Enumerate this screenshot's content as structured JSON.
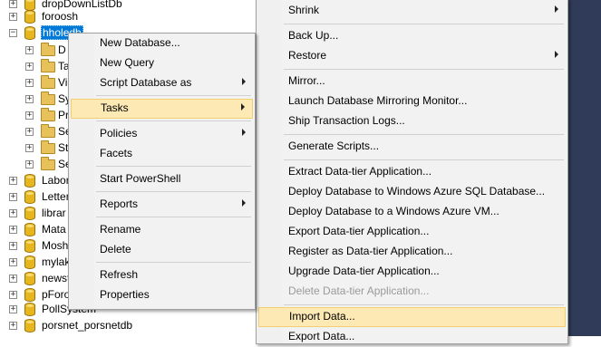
{
  "tree": {
    "items": [
      {
        "label": "dropDownListDb",
        "expander": "+",
        "type": "db"
      },
      {
        "label": "foroosh",
        "expander": "+",
        "type": "db"
      },
      {
        "label": "hholedb",
        "expander": "−",
        "type": "db",
        "selected": true
      },
      {
        "label": "D",
        "type": "folder"
      },
      {
        "label": "Ta",
        "type": "folder"
      },
      {
        "label": "Vi",
        "type": "folder"
      },
      {
        "label": "Sy",
        "type": "folder"
      },
      {
        "label": "Pr",
        "type": "folder"
      },
      {
        "label": "Se",
        "type": "folder"
      },
      {
        "label": "St",
        "type": "folder"
      },
      {
        "label": "Se",
        "type": "folder"
      },
      {
        "label": "Labor",
        "expander": "+",
        "type": "db"
      },
      {
        "label": "Letter",
        "expander": "+",
        "type": "db"
      },
      {
        "label": "librar",
        "expander": "+",
        "type": "db"
      },
      {
        "label": "Mata",
        "expander": "+",
        "type": "db"
      },
      {
        "label": "Mosh",
        "expander": "+",
        "type": "db"
      },
      {
        "label": "mylak",
        "expander": "+",
        "type": "db"
      },
      {
        "label": "newst",
        "expander": "+",
        "type": "db"
      },
      {
        "label": "pForo",
        "expander": "+",
        "type": "db"
      },
      {
        "label": "PollSystem",
        "expander": "+",
        "type": "db"
      },
      {
        "label": "porsnet_porsnetdb",
        "expander": "+",
        "type": "db"
      }
    ]
  },
  "context_menu": {
    "items": [
      {
        "label": "New Database..."
      },
      {
        "label": "New Query"
      },
      {
        "label": "Script Database as",
        "submenu": true
      },
      {
        "label": "Tasks",
        "submenu": true,
        "highlighted": true
      },
      {
        "label": "Policies",
        "submenu": true
      },
      {
        "label": "Facets"
      },
      {
        "label": "Start PowerShell"
      },
      {
        "label": "Reports",
        "submenu": true
      },
      {
        "label": "Rename"
      },
      {
        "label": "Delete"
      },
      {
        "label": "Refresh"
      },
      {
        "label": "Properties"
      }
    ]
  },
  "tasks_menu": {
    "items": [
      {
        "label": "Shrink",
        "submenu": true
      },
      {
        "label": "Back Up..."
      },
      {
        "label": "Restore",
        "submenu": true
      },
      {
        "label": "Mirror..."
      },
      {
        "label": "Launch Database Mirroring Monitor..."
      },
      {
        "label": "Ship Transaction Logs..."
      },
      {
        "label": "Generate Scripts..."
      },
      {
        "label": "Extract Data-tier Application..."
      },
      {
        "label": "Deploy Database to Windows Azure SQL Database..."
      },
      {
        "label": "Deploy Database to a Windows Azure VM..."
      },
      {
        "label": "Export Data-tier Application..."
      },
      {
        "label": "Register as Data-tier Application..."
      },
      {
        "label": "Upgrade Data-tier Application..."
      },
      {
        "label": "Delete Data-tier Application...",
        "disabled": true
      },
      {
        "label": "Import Data...",
        "highlighted": true
      },
      {
        "label": "Export Data..."
      }
    ]
  },
  "colors": {
    "selection": "#0078d7",
    "menu_highlight": "#fde9b4",
    "menu_background": "#f2f2f2",
    "disabled_text": "#9a9a9a"
  }
}
